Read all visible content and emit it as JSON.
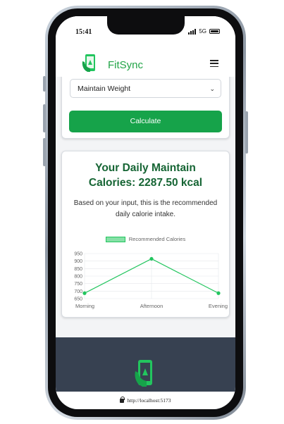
{
  "status": {
    "time": "15:41",
    "network": "5G"
  },
  "navbar": {
    "brand": "FitSync",
    "logo_icon": "phone-fitness-logo-icon",
    "menu_icon": "hamburger-menu-icon"
  },
  "form": {
    "goal_selected": "Maintain Weight",
    "calculate_label": "Calculate"
  },
  "result": {
    "title_line1": "Your Daily Maintain",
    "title_line2": "Calories: 2287.50 kcal",
    "description": "Based on your input, this is the recommended daily calorie intake."
  },
  "chart_data": {
    "type": "line",
    "categories": [
      "Morning",
      "Afternoon",
      "Evening"
    ],
    "series": [
      {
        "name": "Recommended Calories",
        "values": [
          686.25,
          915.0,
          686.25
        ]
      }
    ],
    "ylim": [
      650,
      950
    ],
    "yticks": [
      "650",
      "700",
      "750",
      "800",
      "850",
      "900",
      "950"
    ],
    "color": "#22c55e",
    "legend": "top"
  },
  "urlbar": {
    "url": "http://localhost:5173"
  },
  "colors": {
    "accent": "#16a34a",
    "title": "#166534",
    "footer": "#374151"
  }
}
